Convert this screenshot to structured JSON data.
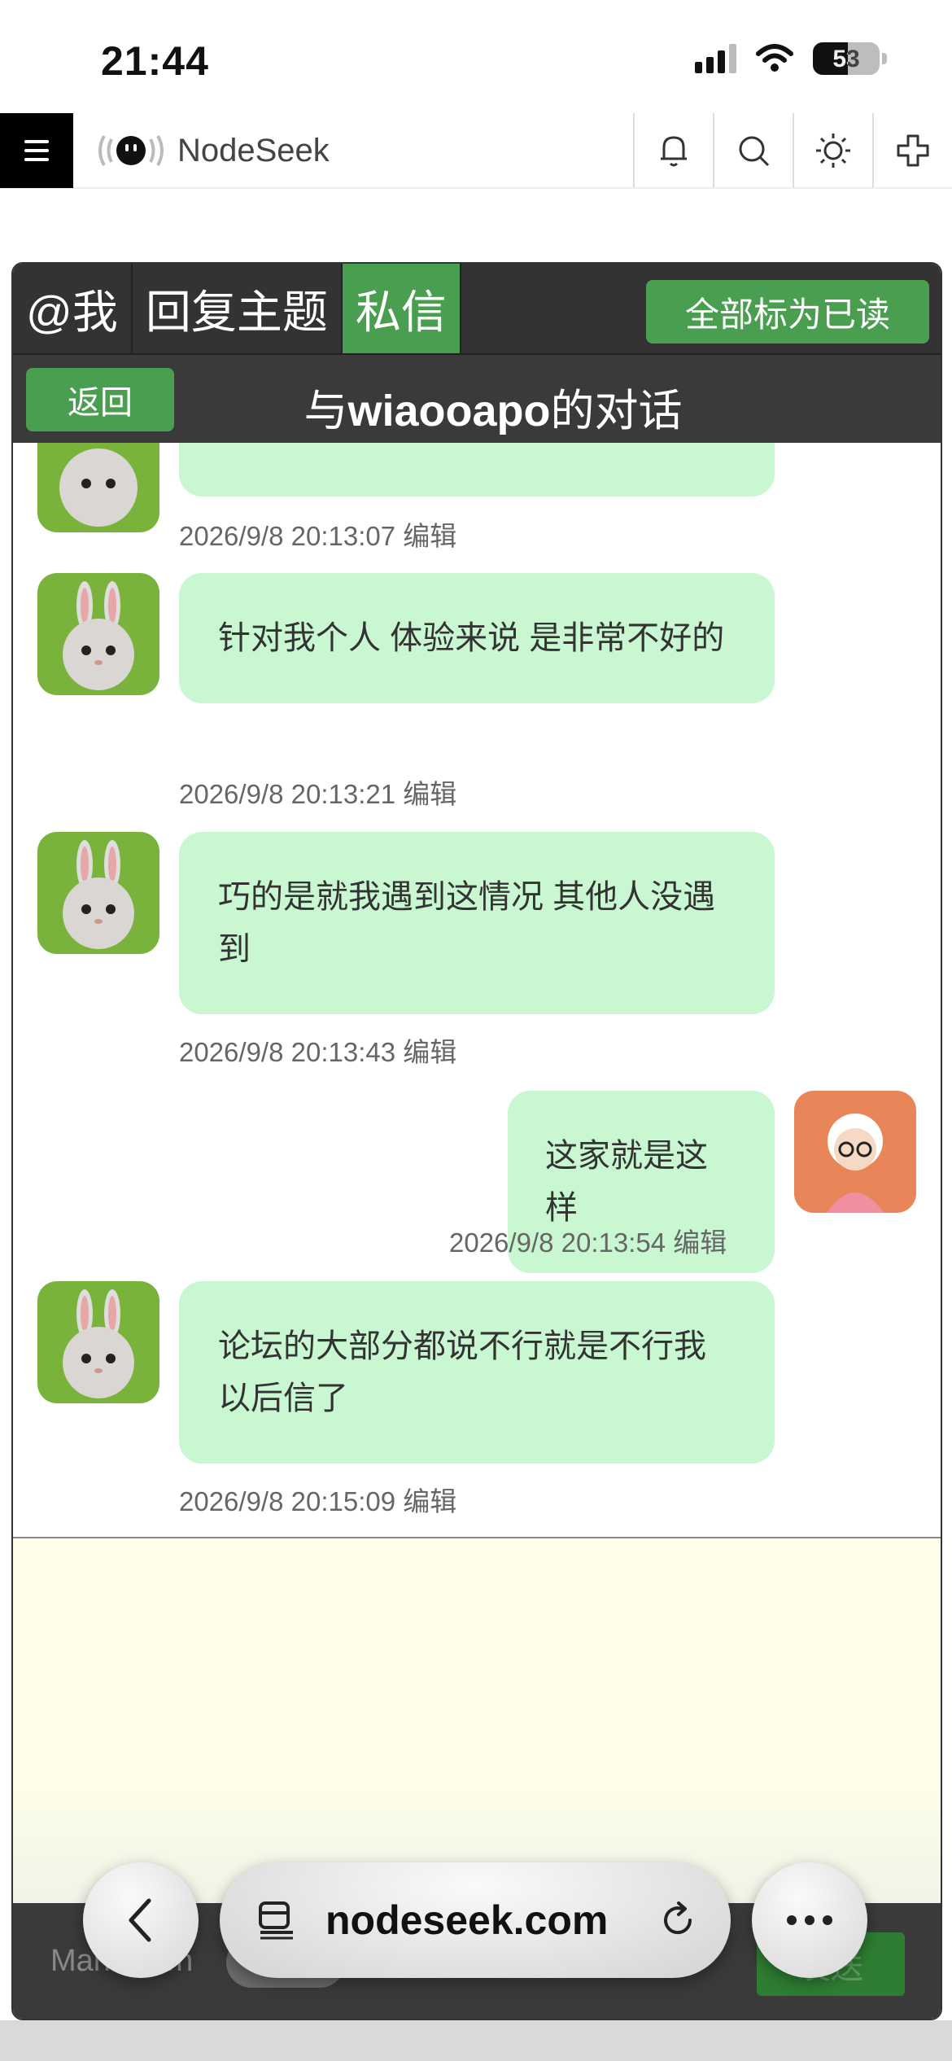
{
  "status_bar": {
    "time": "21:44",
    "battery": "53"
  },
  "topnav": {
    "brand": "NodeSeek"
  },
  "tabs": [
    {
      "label": "@我"
    },
    {
      "label": "回复主题"
    },
    {
      "label": "私信"
    }
  ],
  "mark_all_read": "全部标为已读",
  "conversation": {
    "back_label": "返回",
    "title_prefix": "与",
    "title_user": "wiaooapo",
    "title_suffix": "的对话"
  },
  "messages": [
    {
      "side": "left",
      "text": "",
      "time": "2026/9/8 20:13:07",
      "edit": "编辑"
    },
    {
      "side": "left",
      "text": "针对我个人 体验来说 是非常不好的",
      "time": "2026/9/8 20:13:21",
      "edit": "编辑"
    },
    {
      "side": "left",
      "text": "巧的是就我遇到这情况 其他人没遇到",
      "time": "2026/9/8 20:13:43",
      "edit": "编辑"
    },
    {
      "side": "right",
      "text": "这家就是这样",
      "time": "2026/9/8 20:13:54",
      "edit": "编辑"
    },
    {
      "side": "left",
      "text": "论坛的大部分都说不行就是不行我以后信了",
      "time": "2026/9/8 20:15:09",
      "edit": "编辑"
    }
  ],
  "compose": {
    "markdown_label": "Markdown",
    "send_label": "发送"
  },
  "browser": {
    "url": "nodeseek.com"
  },
  "colors": {
    "accent_green": "#4a9e4f",
    "bubble": "#c8f7d2",
    "header_dark": "#333333"
  }
}
